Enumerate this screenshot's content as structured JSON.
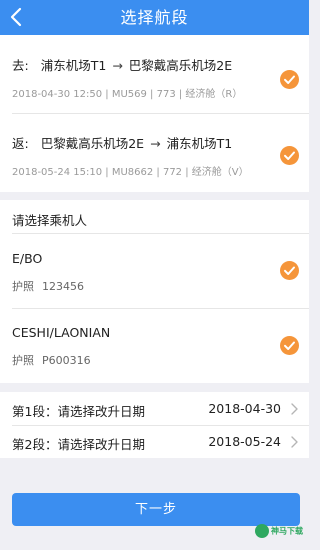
{
  "header": {
    "title": "选择航段",
    "back_icon": "chevron-left-icon"
  },
  "flights": [
    {
      "direction": "去:",
      "from": "浦东机场T1",
      "arrow": "→",
      "to": "巴黎戴高乐机场2E",
      "detail": "2018-04-30 12:50 | MU569 | 773 | 经济舱（R）",
      "selected": true
    },
    {
      "direction": "返:",
      "from": "巴黎戴高乐机场2E",
      "arrow": "→",
      "to": "浦东机场T1",
      "detail": "2018-05-24 15:10 | MU8662 | 772 | 经济舱（V）",
      "selected": true
    }
  ],
  "passengers": {
    "heading": "请选择乘机人",
    "items": [
      {
        "name": "E/BO",
        "doc_type": "护照",
        "doc_number": "123456",
        "selected": true
      },
      {
        "name": "CESHI/LAONIAN",
        "doc_type": "护照",
        "doc_number": "P600316",
        "selected": true
      }
    ]
  },
  "change_dates": [
    {
      "label": "第1段：请选择改升日期",
      "date": "2018-04-30"
    },
    {
      "label": "第2段：请选择改升日期",
      "date": "2018-05-24"
    }
  ],
  "next_button": "下一步",
  "watermark": "神马下载",
  "colors": {
    "primary": "#3b8ef0",
    "accent": "#f5953a",
    "background": "#efeff4"
  }
}
